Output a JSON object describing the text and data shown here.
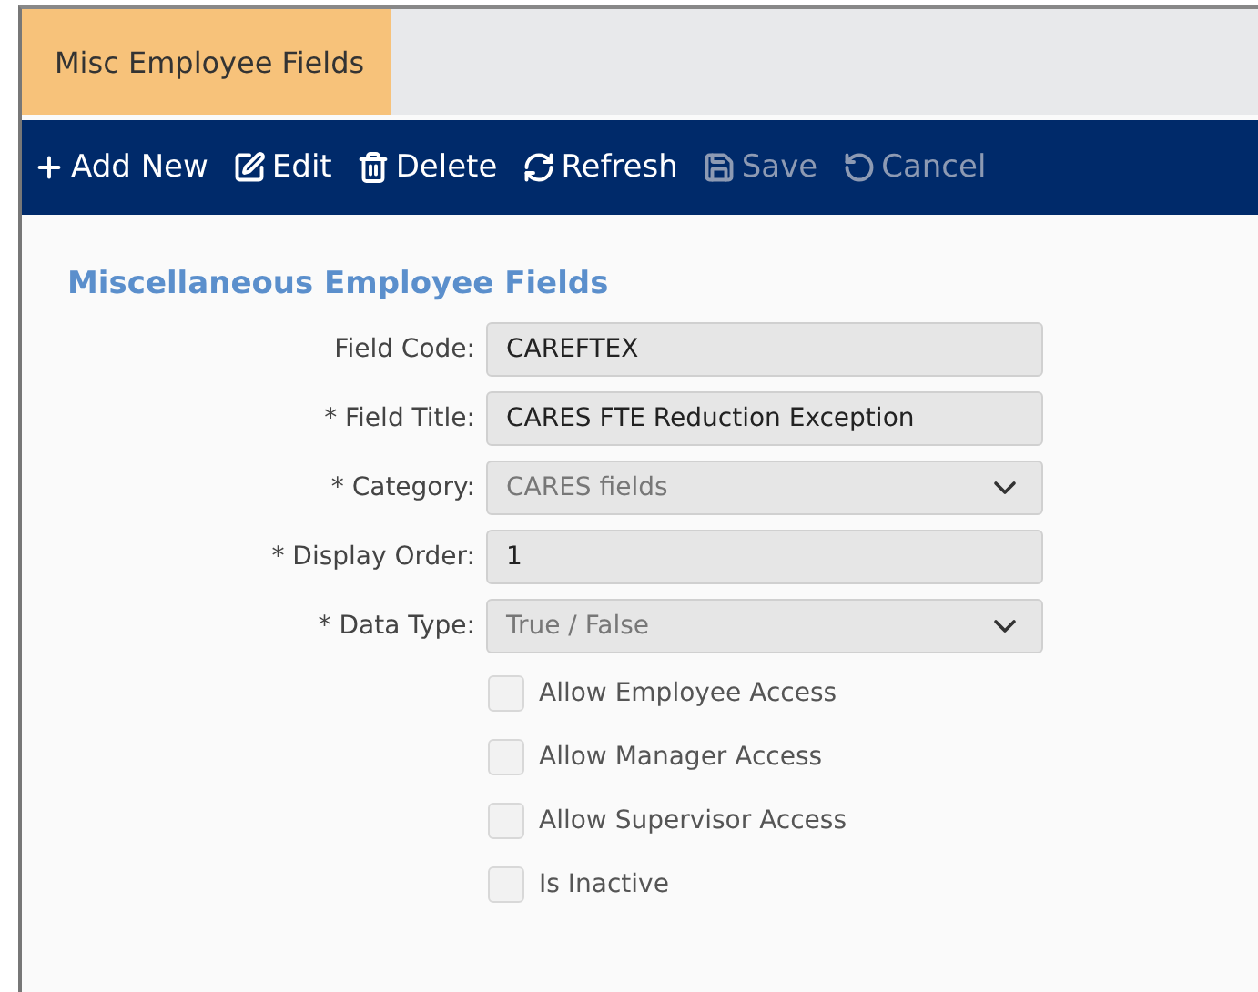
{
  "tabs": [
    {
      "label": "Misc Employee Fields",
      "selected": true
    }
  ],
  "toolbar": [
    {
      "label": "Add New",
      "kind": "add",
      "disabled": false
    },
    {
      "label": "Edit",
      "kind": "edit",
      "disabled": false
    },
    {
      "label": "Delete",
      "kind": "delete",
      "disabled": false
    },
    {
      "label": "Refresh",
      "kind": "refresh",
      "disabled": false
    },
    {
      "label": "Save",
      "kind": "save",
      "disabled": true
    },
    {
      "label": "Cancel",
      "kind": "cancel",
      "disabled": true
    }
  ],
  "section_title": "Miscellaneous Employee Fields",
  "fields": [
    {
      "label": "Field Code:",
      "kind": "text",
      "value": "CAREFTEX",
      "disabled": false
    },
    {
      "label": "* Field Title:",
      "kind": "text",
      "value": "CARES FTE Reduction Exception",
      "disabled": false
    },
    {
      "label": "* Category:",
      "kind": "select",
      "value": "CARES fields",
      "disabled": true
    },
    {
      "label": "* Display Order:",
      "kind": "text",
      "value": "1",
      "disabled": false
    },
    {
      "label": "* Data Type:",
      "kind": "select",
      "value": "True / False",
      "disabled": true
    }
  ],
  "checkboxes": [
    {
      "label": "Allow Employee Access",
      "checked": false
    },
    {
      "label": "Allow Manager Access",
      "checked": false
    },
    {
      "label": "Allow Supervisor Access",
      "checked": false
    },
    {
      "label": "Is Inactive",
      "checked": false
    }
  ]
}
